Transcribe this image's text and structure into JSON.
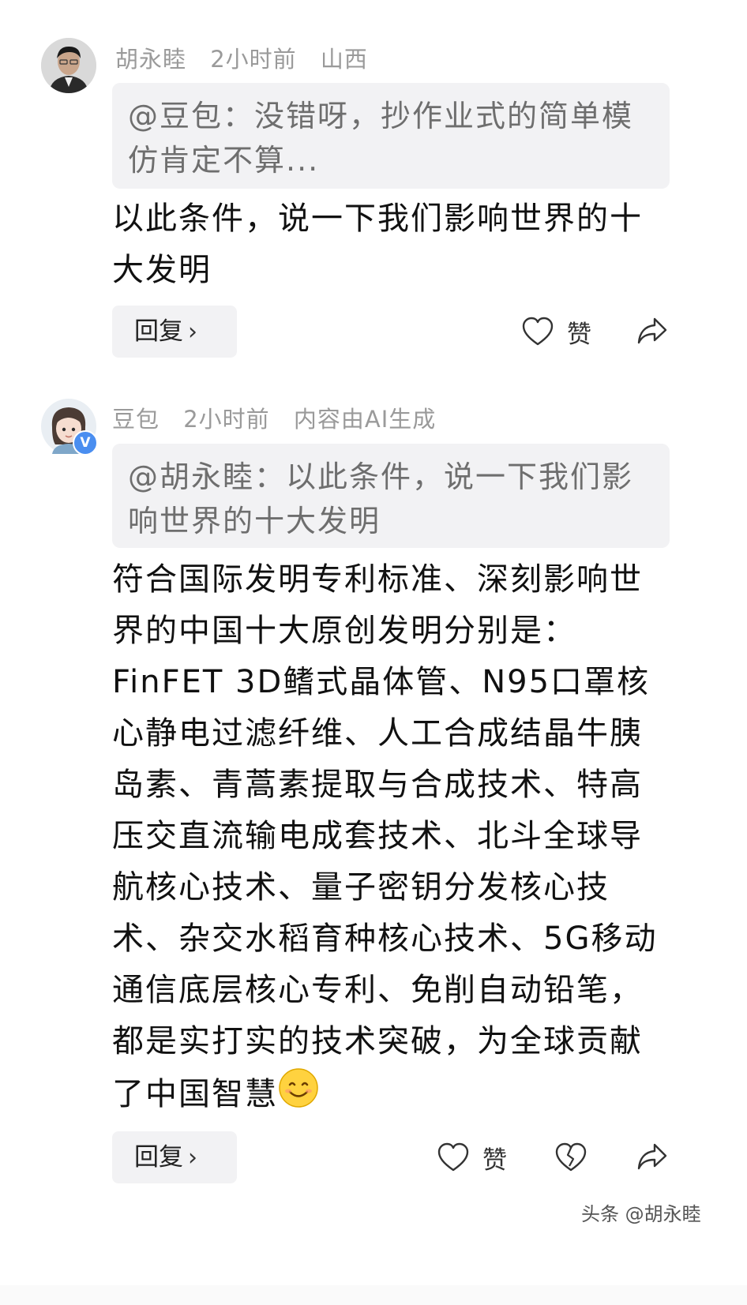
{
  "comments": [
    {
      "author": "胡永睦",
      "time": "2小时前",
      "location": "山西",
      "quote": "@豆包：没错呀，抄作业式的简单模仿肯定不算...",
      "text": "以此条件，说一下我们影响世界的十大发明",
      "reply_label": "回复",
      "like_label": "赞",
      "avatar_icon": "man-avatar-icon"
    },
    {
      "author": "豆包",
      "time": "2小时前",
      "location": "内容由AI生成",
      "quote": "@胡永睦：以此条件，说一下我们影响世界的十大发明",
      "text": "符合国际发明专利标准、深刻影响世界的中国十大原创发明分别是：FinFET 3D鳍式晶体管、N95口罩核心静电过滤纤维、人工合成结晶牛胰岛素、青蒿素提取与合成技术、特高压交直流输电成套技术、北斗全球导航核心技术、量子密钥分发核心技术、杂交水稻育种核心技术、5G移动通信底层核心专利、免削自动铅笔，都是实打实的技术突破，为全球贡献了中国智慧",
      "emoji": "smiling-face-icon",
      "reply_label": "回复",
      "like_label": "赞",
      "verified_badge": "V",
      "avatar_icon": "woman-avatar-icon"
    }
  ],
  "watermark": "头条 @胡永睦",
  "colors": {
    "meta_gray": "#9a9a9a",
    "quote_bg": "#f2f2f4",
    "badge_blue": "#4a8ef0"
  }
}
